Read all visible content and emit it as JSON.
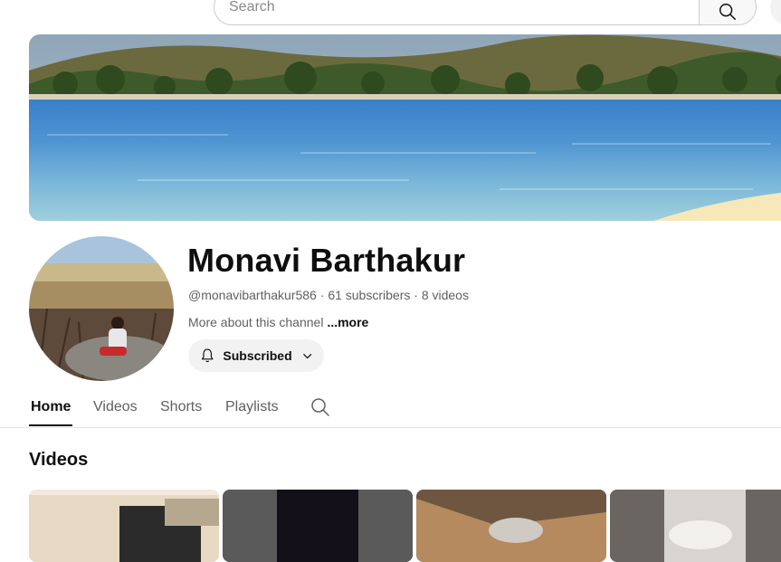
{
  "search": {
    "placeholder": "Search"
  },
  "channel": {
    "name": "Monavi Barthakur",
    "handle": "@monavibarthakur586",
    "subscribers": "61 subscribers",
    "videos": "8 videos",
    "separator": "·",
    "about_text": "More about this channel",
    "about_more": "...more",
    "subscribe_label": "Subscribed"
  },
  "tabs": [
    {
      "label": "Home",
      "active": true
    },
    {
      "label": "Videos",
      "active": false
    },
    {
      "label": "Shorts",
      "active": false
    },
    {
      "label": "Playlists",
      "active": false
    }
  ],
  "section": {
    "title": "Videos"
  },
  "icons": {
    "search": "search-icon",
    "bell": "bell-icon",
    "chevron": "chevron-down-icon",
    "tab_search": "search-icon"
  }
}
